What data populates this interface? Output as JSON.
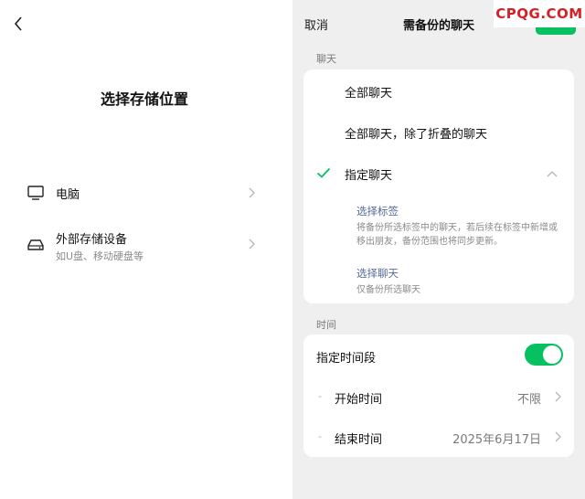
{
  "left": {
    "title": "选择存储位置",
    "options": [
      {
        "label": "电脑",
        "sub": "",
        "icon": "monitor-icon"
      },
      {
        "label": "外部存储设备",
        "sub": "如U盘、移动硬盘等",
        "icon": "external-drive-icon"
      }
    ]
  },
  "right": {
    "cancel": "取消",
    "title": "需备份的聊天",
    "chat_section": "聊天",
    "chat_options": [
      {
        "label": "全部聊天",
        "selected": false
      },
      {
        "label": "全部聊天，除了折叠的聊天",
        "selected": false
      },
      {
        "label": "指定聊天",
        "selected": true
      }
    ],
    "sub_options": [
      {
        "title": "选择标签",
        "desc": "将备份所选标签中的聊天，若后续在标签中新增或移出朋友，备份范围也将同步更新。"
      },
      {
        "title": "选择聊天",
        "desc": "仅备份所选聊天"
      }
    ],
    "time_section": "时间",
    "time_toggle_label": "指定时间段",
    "time_toggle_on": true,
    "start_dash": "-",
    "start_label": "开始时间",
    "start_value": "不限",
    "end_dash": "-",
    "end_label": "结束时间",
    "end_value": "2025年6月17日"
  },
  "watermark": "CPQG.COM",
  "colors": {
    "accent": "#07c160",
    "link": "#576b95",
    "watermark": "#d42027"
  }
}
